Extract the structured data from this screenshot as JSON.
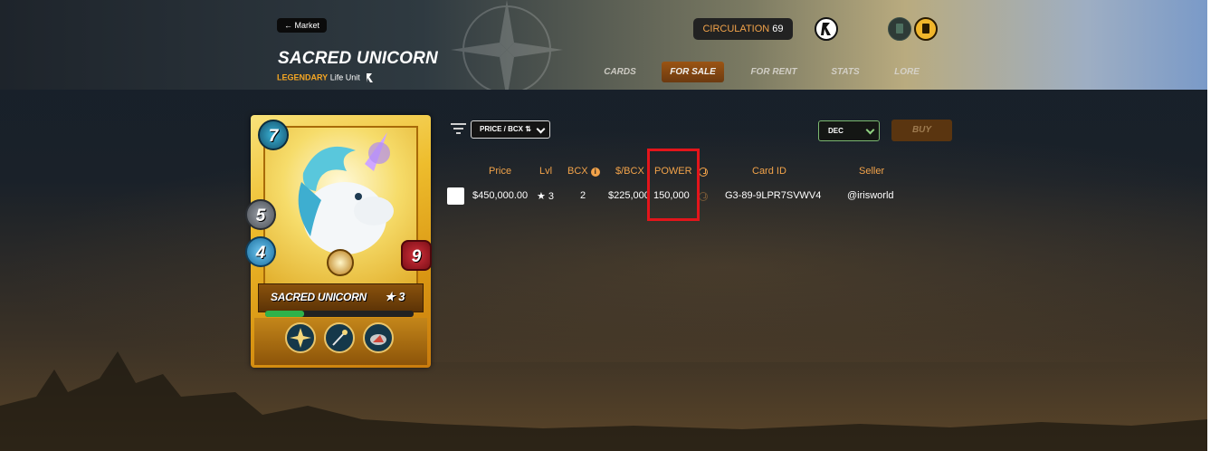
{
  "header": {
    "back_label": "← Market",
    "card_title": "SACRED UNICORN",
    "rarity": "LEGENDARY",
    "unit_type": "Life Unit",
    "circulation_label": "CIRCULATION",
    "circulation_value": "69"
  },
  "nav": {
    "tabs": [
      {
        "label": "CARDS",
        "active": false
      },
      {
        "label": "FOR SALE",
        "active": true
      },
      {
        "label": "FOR RENT",
        "active": false
      },
      {
        "label": "STATS",
        "active": false
      },
      {
        "label": "LORE",
        "active": false
      }
    ]
  },
  "card": {
    "name": "SACRED UNICORN",
    "level": "★ 3",
    "mana": "7",
    "attack": "5",
    "speed": "4",
    "health": "9",
    "xp_progress": 0.26,
    "abilities": [
      "ability-icon-spark",
      "ability-icon-wand",
      "ability-icon-shield"
    ],
    "colors": {
      "frame": "#eebd2d",
      "mana": "#2a8fb4",
      "health": "#b41f2a"
    }
  },
  "controls": {
    "sort_value": "PRICE / BCX ⇅",
    "currency_value": "DEC",
    "buy_label": "BUY"
  },
  "table": {
    "headers": {
      "price": "Price",
      "lvl": "Lvl",
      "bcx": "BCX",
      "per_bcx": "$/BCX",
      "power": "POWER",
      "card_id": "Card ID",
      "seller": "Seller"
    },
    "rows": [
      {
        "price": "$450,000.00",
        "lvl": "★ 3",
        "bcx": "2",
        "per_bcx": "$225,000",
        "power": "150,000",
        "card_id": "G3-89-9LPR7SVWV4",
        "seller": "@irisworld"
      }
    ]
  },
  "colors": {
    "accent": "#f2a34a",
    "highlight": "#e3151b",
    "active_tab": "#a0520c"
  }
}
